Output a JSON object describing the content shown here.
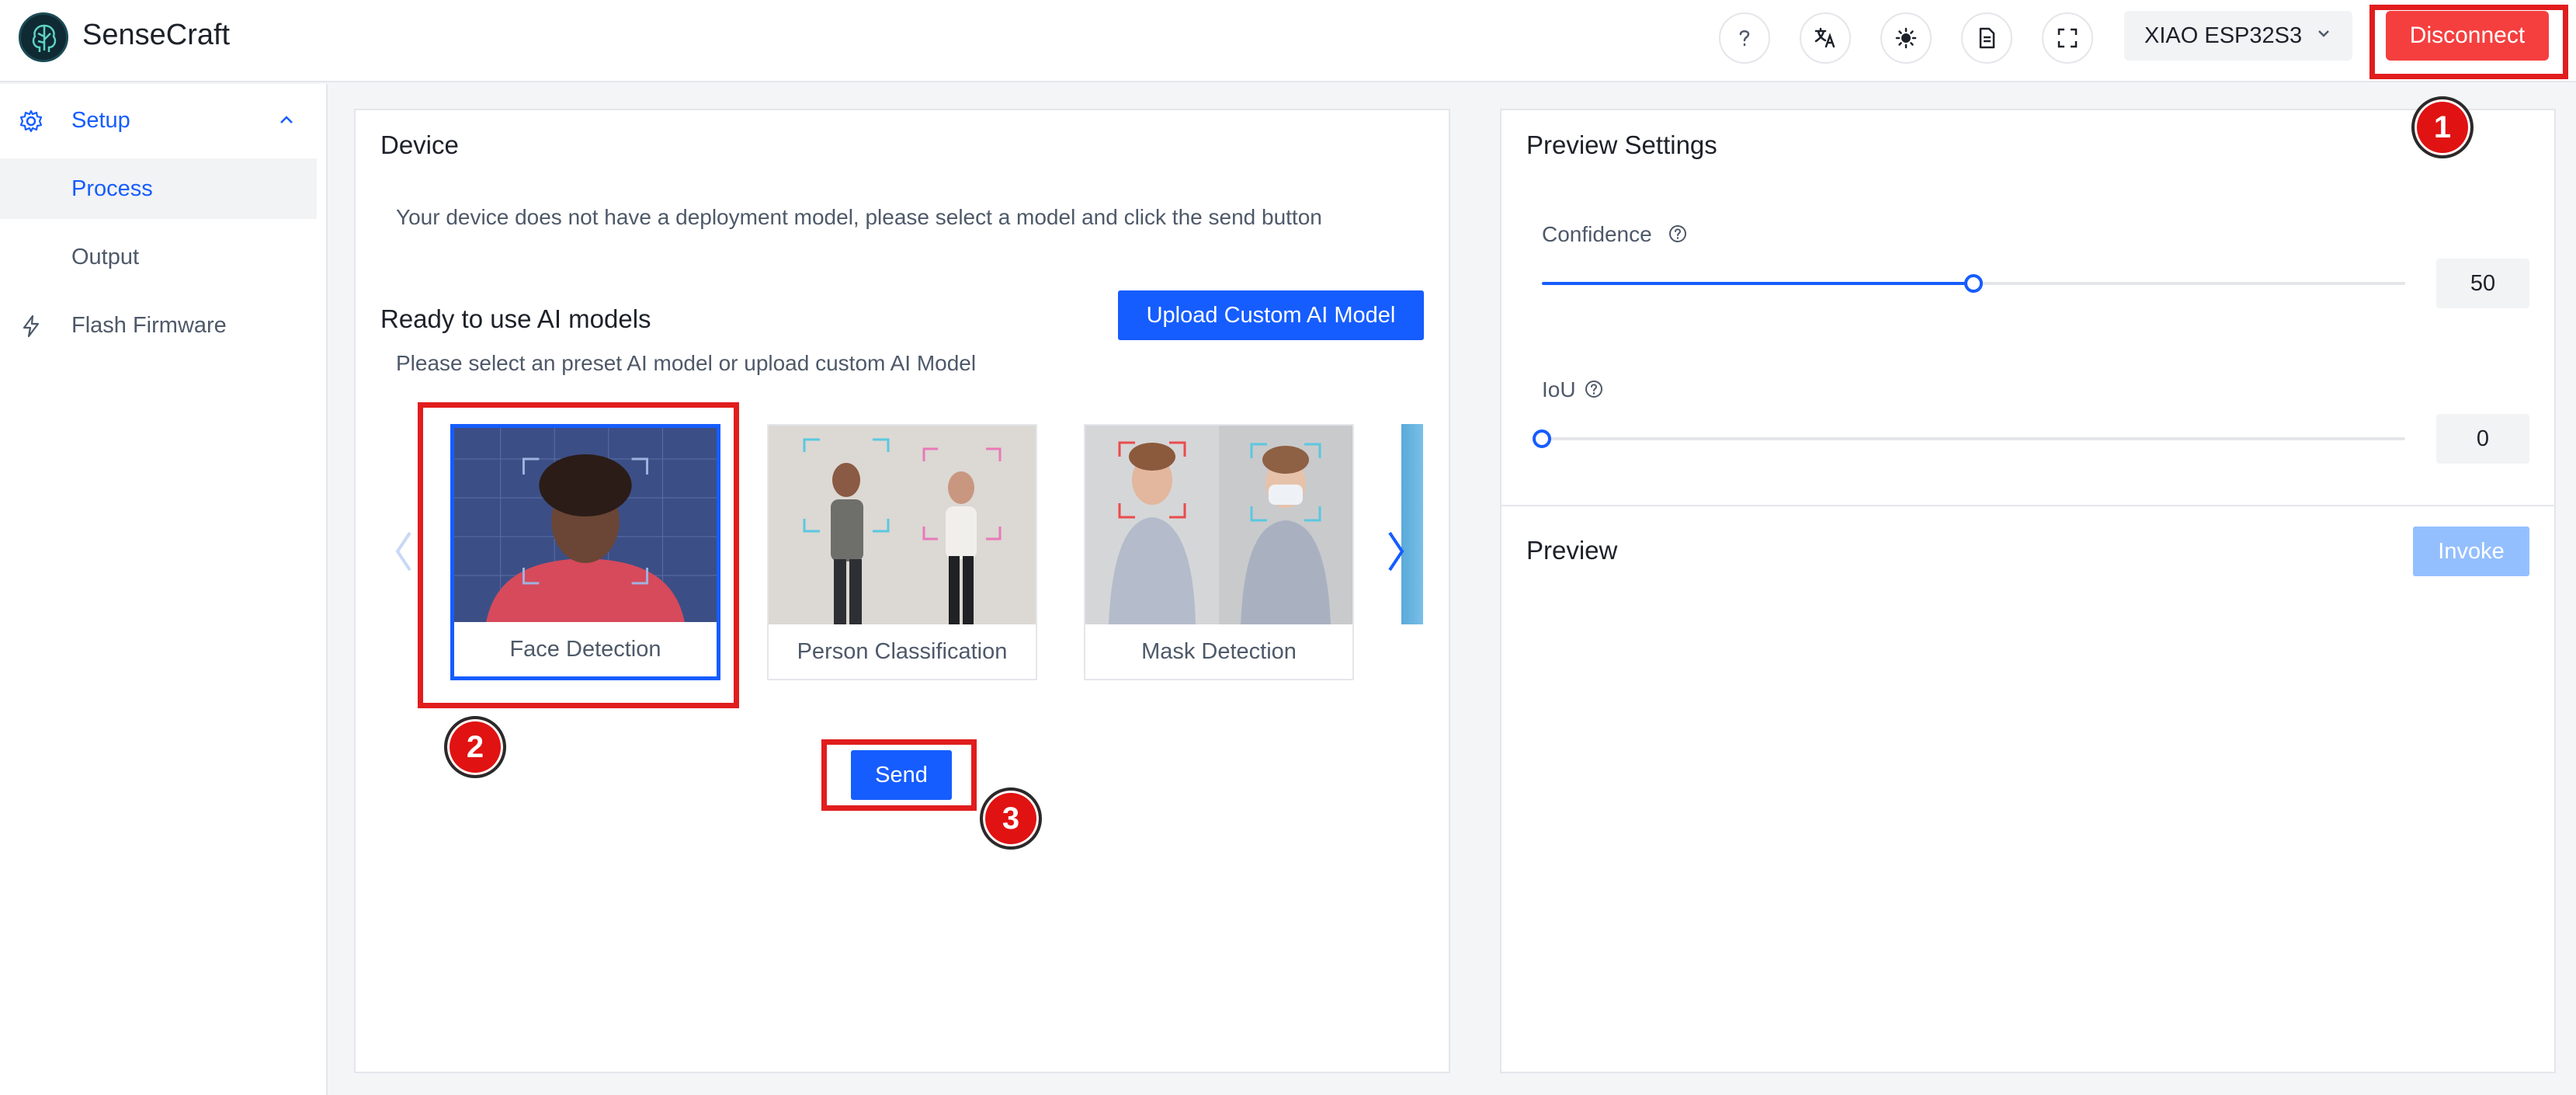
{
  "app": {
    "title": "SenseCraft"
  },
  "header": {
    "icons": [
      "help-icon",
      "translate-icon",
      "theme-icon",
      "document-icon",
      "fullscreen-icon"
    ],
    "device_select": {
      "value": "XIAO ESP32S3"
    },
    "disconnect_label": "Disconnect"
  },
  "sidebar": {
    "items": [
      {
        "label": "Setup",
        "icon": "gear-icon",
        "expanded": true
      },
      {
        "label": "Process"
      },
      {
        "label": "Output"
      },
      {
        "label": "Flash Firmware",
        "icon": "lightning-icon"
      }
    ]
  },
  "device_card": {
    "title": "Device",
    "message": "Your device does not have a deployment model, please select a model and click the send button",
    "models_title": "Ready to use AI models",
    "models_subtitle": "Please select an preset AI model or upload custom AI Model",
    "upload_label": "Upload Custom AI Model",
    "models": [
      {
        "label": "Face Detection",
        "selected": true
      },
      {
        "label": "Person Classification",
        "selected": false
      },
      {
        "label": "Mask Detection",
        "selected": false
      }
    ],
    "send_label": "Send"
  },
  "preview_settings": {
    "title": "Preview Settings",
    "confidence": {
      "label": "Confidence",
      "value": "50",
      "fraction": 0.5
    },
    "iou": {
      "label": "IoU",
      "value": "0",
      "fraction": 0
    }
  },
  "preview": {
    "title": "Preview",
    "invoke_label": "Invoke"
  },
  "annotations": {
    "markers": [
      "1",
      "2",
      "3"
    ]
  },
  "colors": {
    "accent": "#165dff",
    "danger": "#f53f3f",
    "annotation": "#e11d1d"
  }
}
